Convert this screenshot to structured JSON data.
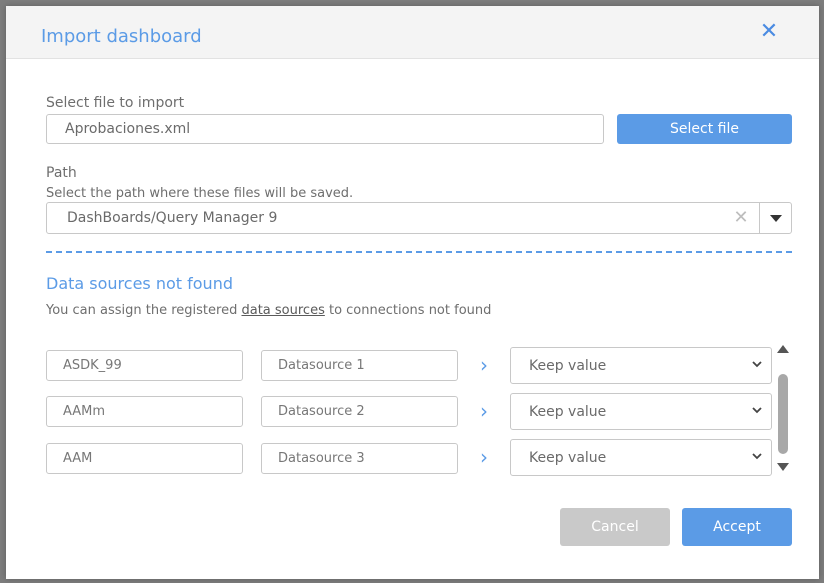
{
  "dialog": {
    "title": "Import dashboard",
    "close_icon": "close-icon"
  },
  "file": {
    "label": "Select file to import",
    "value": "Aprobaciones.xml",
    "button_label": "Select file"
  },
  "path": {
    "label": "Path",
    "hint": "Select the path where these files will be saved.",
    "value": "DashBoards/Query Manager 9"
  },
  "datasources": {
    "title": "Data sources not found",
    "hint_before": "You can assign the registered ",
    "hint_link": "data sources",
    "hint_after": " to connections not found",
    "rows": [
      {
        "connection": "ASDK_99",
        "datasource": "Datasource 1",
        "selected": "Keep value"
      },
      {
        "connection": "AAMm",
        "datasource": "Datasource 2",
        "selected": "Keep value"
      },
      {
        "connection": "AAM",
        "datasource": "Datasource 3",
        "selected": "Keep value"
      }
    ]
  },
  "footer": {
    "cancel_label": "Cancel",
    "accept_label": "Accept"
  },
  "colors": {
    "accent": "#5b9be6",
    "disabled": "#c9c9c9",
    "backdrop": "#7d7d7d"
  }
}
